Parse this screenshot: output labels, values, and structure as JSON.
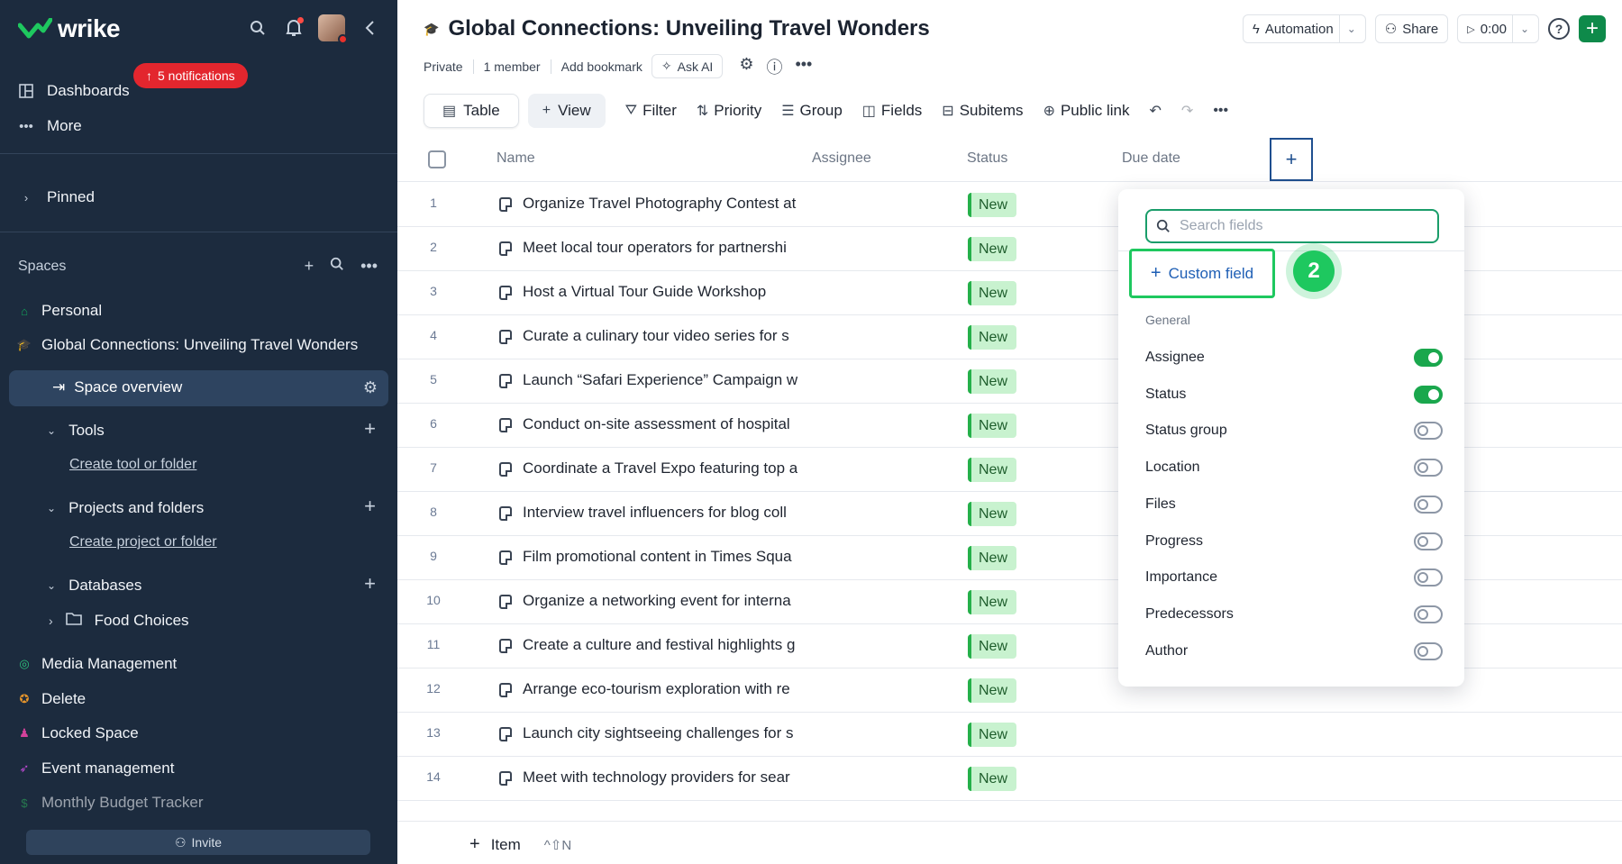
{
  "brand": {
    "logo_text": "wrike"
  },
  "notifications": {
    "badge_label": "5 notifications"
  },
  "sidebar": {
    "nav": [
      {
        "label": "Dashboards",
        "icon": "dashboard-icon"
      },
      {
        "label": "More",
        "icon": "more-dots-icon"
      }
    ],
    "pinned_label": "Pinned",
    "spaces_title": "Spaces",
    "spaces": [
      {
        "label": "Personal",
        "icon": "home-icon",
        "color": "#11a55a"
      },
      {
        "label": "Global Connections: Unveiling Travel Wonders",
        "icon": "graduation-cap-icon",
        "color": "#11a5a0"
      }
    ],
    "space_overview_label": "Space overview",
    "tree": {
      "tools_label": "Tools",
      "create_tool_link": "Create tool or folder",
      "projects_label": "Projects and folders",
      "create_project_link": "Create project or folder",
      "databases_label": "Databases",
      "food_choices_label": "Food Choices"
    },
    "other_spaces": [
      {
        "label": "Media Management",
        "icon": "target-icon",
        "color": "#2ec27e"
      },
      {
        "label": "Delete",
        "icon": "medal-icon",
        "color": "#e8962b"
      },
      {
        "label": "Locked Space",
        "icon": "person-lock-icon",
        "color": "#d4429b"
      },
      {
        "label": "Event management",
        "icon": "rocket-icon",
        "color": "#c04ad6"
      },
      {
        "label": "Monthly Budget Tracker",
        "icon": "dollar-icon",
        "color": "#2eae5a"
      }
    ],
    "invite_label": "Invite"
  },
  "header": {
    "title": "Global Connections: Unveiling Travel Wonders",
    "meta": {
      "privacy": "Private",
      "members": "1 member",
      "bookmark": "Add bookmark",
      "ask_ai": "Ask AI"
    },
    "automation_label": "Automation",
    "share_label": "Share",
    "timer_label": "0:00"
  },
  "toolbar": {
    "table_label": "Table",
    "view_label": "View",
    "filter_label": "Filter",
    "priority_label": "Priority",
    "group_label": "Group",
    "fields_label": "Fields",
    "subitems_label": "Subitems",
    "public_link_label": "Public link"
  },
  "table": {
    "columns": {
      "name": "Name",
      "assignee": "Assignee",
      "status": "Status",
      "due_date": "Due date"
    },
    "rows": [
      {
        "num": "1",
        "name": "Organize Travel Photography Contest at",
        "status": "New"
      },
      {
        "num": "2",
        "name": "Meet local tour operators for partnershi",
        "status": "New"
      },
      {
        "num": "3",
        "name": "Host a Virtual Tour Guide Workshop",
        "status": "New"
      },
      {
        "num": "4",
        "name": "Curate a culinary tour video series for s",
        "status": "New"
      },
      {
        "num": "5",
        "name": "Launch “Safari Experience” Campaign w",
        "status": "New"
      },
      {
        "num": "6",
        "name": "Conduct on-site assessment of hospital",
        "status": "New"
      },
      {
        "num": "7",
        "name": "Coordinate a Travel Expo featuring top a",
        "status": "New"
      },
      {
        "num": "8",
        "name": "Interview travel influencers for blog coll",
        "status": "New"
      },
      {
        "num": "9",
        "name": "Film promotional content in Times Squa",
        "status": "New"
      },
      {
        "num": "10",
        "name": "Organize a networking event for interna",
        "status": "New"
      },
      {
        "num": "11",
        "name": "Create a culture and festival highlights g",
        "status": "New"
      },
      {
        "num": "12",
        "name": "Arrange eco-tourism exploration with re",
        "status": "New"
      },
      {
        "num": "13",
        "name": "Launch city sightseeing challenges for s",
        "status": "New"
      },
      {
        "num": "14",
        "name": "Meet with technology providers for sear",
        "status": "New"
      }
    ],
    "add_item_label": "Item",
    "add_item_shortcut": "^⇧N"
  },
  "fields_panel": {
    "search_placeholder": "Search fields",
    "custom_field_label": "Custom field",
    "step_number": "2",
    "section_label": "General",
    "fields": [
      {
        "label": "Assignee",
        "enabled": true
      },
      {
        "label": "Status",
        "enabled": true
      },
      {
        "label": "Status group",
        "enabled": false
      },
      {
        "label": "Location",
        "enabled": false
      },
      {
        "label": "Files",
        "enabled": false
      },
      {
        "label": "Progress",
        "enabled": false
      },
      {
        "label": "Importance",
        "enabled": false
      },
      {
        "label": "Predecessors",
        "enabled": false
      },
      {
        "label": "Author",
        "enabled": false
      }
    ]
  },
  "colors": {
    "accent_green": "#1ec85f",
    "sidebar_bg": "#1c2b3e",
    "status_new_bg": "#c8f2cf"
  }
}
